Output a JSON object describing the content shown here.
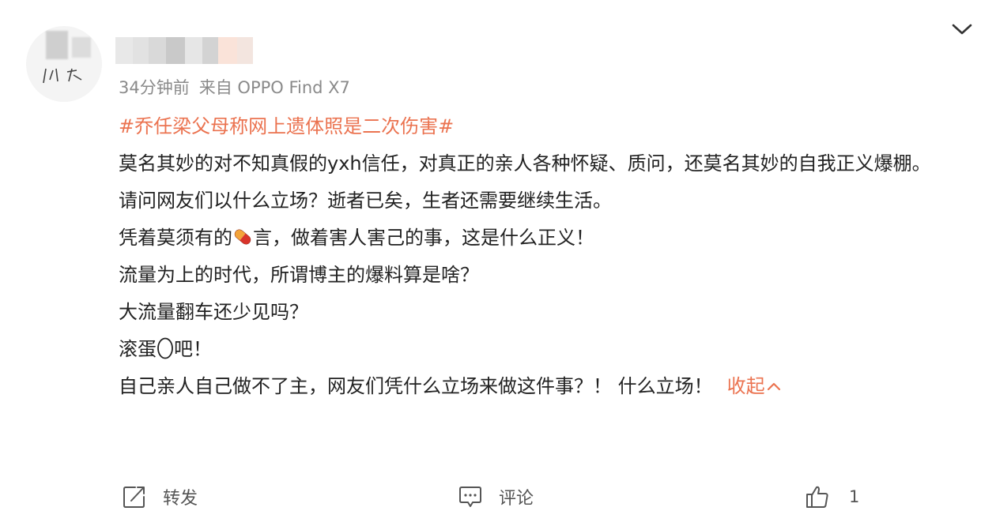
{
  "post": {
    "meta_time": "34分钟前",
    "meta_source": "来自 OPPO Find X7",
    "hashtag": "#乔任梁父母称网上遗体照是二次伤害#",
    "lines": {
      "l1": "莫名其妙的对不知真假的yxh信任，对真正的亲人各种怀疑、质问，还莫名其妙的自我正义爆棚。",
      "l2": "请问网友们以什么立场？逝者已矣，生者还需要继续生活。",
      "l3_pre": "凭着莫须有的",
      "l3_post": "言，做着害人害己的事，这是什么正义！",
      "l4": "流量为上的时代，所谓博主的爆料算是啥？",
      "l5": "大流量翻车还少见吗？",
      "l6_pre": "滚蛋",
      "l6_post": "吧！",
      "l7": "自己亲人自己做不了主，网友们凭什么立场来做这件事？！ 什么立场！"
    },
    "collapse_label": "收起"
  },
  "actions": {
    "repost_label": "转发",
    "comment_label": "评论",
    "like_count": "1"
  },
  "icons": {
    "chevron": "chevron-down-icon",
    "repost": "share-icon",
    "comment": "comment-icon",
    "like": "thumbs-up-icon",
    "pill": "pill-emoji-icon",
    "egg": "egg-emoji-icon"
  },
  "colors": {
    "accent": "#eb7350",
    "text": "#222222",
    "meta": "#8a8a8a"
  }
}
